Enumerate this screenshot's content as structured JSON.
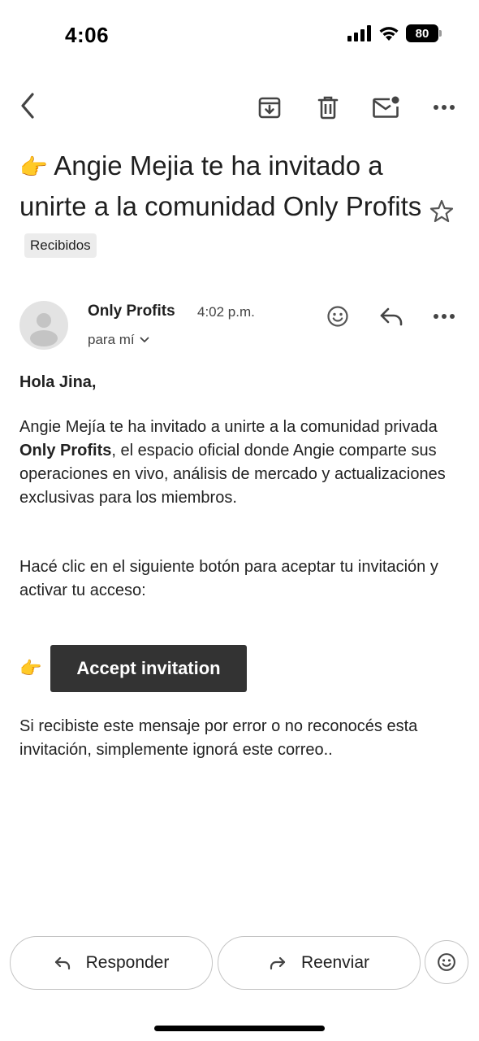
{
  "status_bar": {
    "time": "4:06",
    "battery": "80"
  },
  "toolbar": {
    "icons": [
      "back-arrow-icon",
      "archive-icon",
      "trash-icon",
      "mark-unread-icon",
      "more-options-icon"
    ]
  },
  "email": {
    "subject_emoji": "👉",
    "subject": "Angie Mejia te ha invitado a unirte a la comunidad Only Profits",
    "label": "Recibidos",
    "sender_name": "Only Profits",
    "time": "4:02 p.m.",
    "recipient": "para mí",
    "greeting": "Hola Jina,",
    "para1_before": "Angie Mejía te ha invitado a unirte a la comunidad privada ",
    "para1_bold": "Only Profits",
    "para1_after": ", el espacio oficial donde Angie comparte sus operaciones en vivo, análisis de mercado y actualizaciones exclusivas para los miembros.",
    "para2": "Hacé clic en el siguiente botón para aceptar tu invitación y activar tu acceso:",
    "cta_emoji": "👉",
    "cta_label": "Accept invitation",
    "para3": "Si recibiste este mensaje por error o no reconocés esta invitación, simplemente ignorá este correo.."
  },
  "actions": {
    "reply": "Responder",
    "forward": "Reenviar"
  },
  "colors": {
    "cta_background": "#333333",
    "chip_background": "#ececec",
    "emoji": "#f2b233"
  }
}
